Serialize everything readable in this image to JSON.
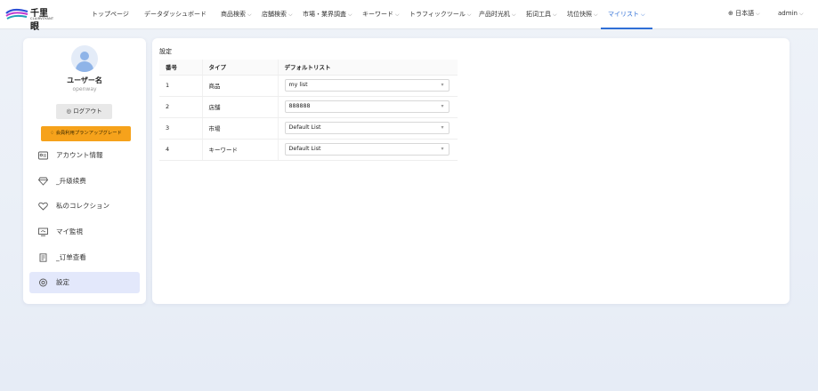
{
  "brand": {
    "name": "千里眼",
    "sub": "CLAIRVOYANT"
  },
  "nav": {
    "items": [
      {
        "label": "トップページ",
        "dropdown": false
      },
      {
        "label": "データダッシュボード",
        "dropdown": false
      },
      {
        "label": "商品検索",
        "dropdown": true
      },
      {
        "label": "店舗検索",
        "dropdown": true
      },
      {
        "label": "市場・業界調査",
        "dropdown": true
      },
      {
        "label": "キーワード",
        "dropdown": true
      },
      {
        "label": "トラフィックツール",
        "dropdown": true
      },
      {
        "label": "产品时光机",
        "dropdown": true
      },
      {
        "label": "拓词工具",
        "dropdown": true
      },
      {
        "label": "坑位快照",
        "dropdown": true
      },
      {
        "label": "マイリスト",
        "dropdown": true,
        "active": true
      }
    ],
    "language": "日本語",
    "user": "admin"
  },
  "profile": {
    "username": "ユーザー名",
    "userid": "openway",
    "logout_label": "ログアウト",
    "upgrade_label": "会員利用プランアップグレード"
  },
  "sidebar": {
    "items": [
      {
        "label": "アカウント情報",
        "icon": "id-card-icon"
      },
      {
        "label": "_升级续费",
        "icon": "diamond-icon"
      },
      {
        "label": "私のコレクション",
        "icon": "heart-icon"
      },
      {
        "label": "マイ監視",
        "icon": "monitor-icon"
      },
      {
        "label": "_订单查看",
        "icon": "receipt-icon"
      },
      {
        "label": "設定",
        "icon": "gear-icon",
        "active": true
      }
    ]
  },
  "settings": {
    "title": "設定",
    "columns": [
      "番号",
      "タイプ",
      "デフォルトリスト"
    ],
    "rows": [
      {
        "num": "1",
        "type": "商品",
        "list": "my list"
      },
      {
        "num": "2",
        "type": "店舗",
        "list": "888888"
      },
      {
        "num": "3",
        "type": "市場",
        "list": "Default List"
      },
      {
        "num": "4",
        "type": "キーワード",
        "list": "Default List"
      }
    ]
  },
  "colors": {
    "accent": "#2f6fd6",
    "upgrade": "#f6a21b",
    "active_bg": "#e3e8fb"
  }
}
